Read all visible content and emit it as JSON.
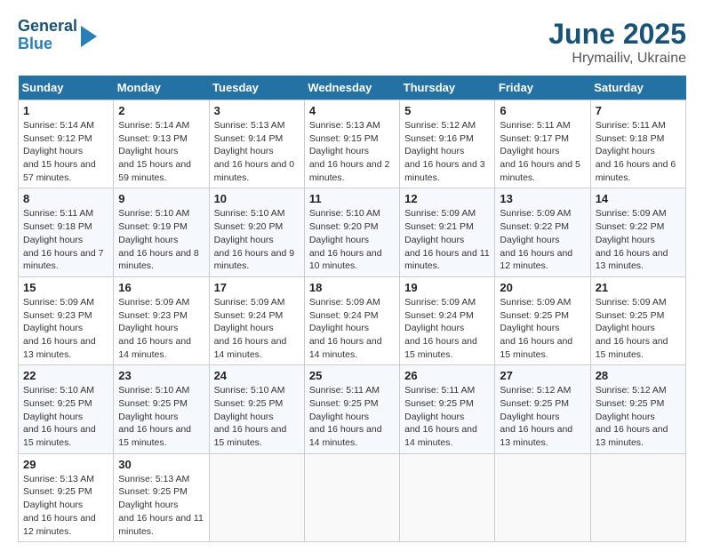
{
  "logo": {
    "line1": "General",
    "line2": "Blue"
  },
  "title": "June 2025",
  "subtitle": "Hrymailiv, Ukraine",
  "days_header": [
    "Sunday",
    "Monday",
    "Tuesday",
    "Wednesday",
    "Thursday",
    "Friday",
    "Saturday"
  ],
  "weeks": [
    [
      {
        "num": "1",
        "sunrise": "5:14 AM",
        "sunset": "9:12 PM",
        "daylight": "15 hours and 57 minutes."
      },
      {
        "num": "2",
        "sunrise": "5:14 AM",
        "sunset": "9:13 PM",
        "daylight": "15 hours and 59 minutes."
      },
      {
        "num": "3",
        "sunrise": "5:13 AM",
        "sunset": "9:14 PM",
        "daylight": "16 hours and 0 minutes."
      },
      {
        "num": "4",
        "sunrise": "5:13 AM",
        "sunset": "9:15 PM",
        "daylight": "16 hours and 2 minutes."
      },
      {
        "num": "5",
        "sunrise": "5:12 AM",
        "sunset": "9:16 PM",
        "daylight": "16 hours and 3 minutes."
      },
      {
        "num": "6",
        "sunrise": "5:11 AM",
        "sunset": "9:17 PM",
        "daylight": "16 hours and 5 minutes."
      },
      {
        "num": "7",
        "sunrise": "5:11 AM",
        "sunset": "9:18 PM",
        "daylight": "16 hours and 6 minutes."
      }
    ],
    [
      {
        "num": "8",
        "sunrise": "5:11 AM",
        "sunset": "9:18 PM",
        "daylight": "16 hours and 7 minutes."
      },
      {
        "num": "9",
        "sunrise": "5:10 AM",
        "sunset": "9:19 PM",
        "daylight": "16 hours and 8 minutes."
      },
      {
        "num": "10",
        "sunrise": "5:10 AM",
        "sunset": "9:20 PM",
        "daylight": "16 hours and 9 minutes."
      },
      {
        "num": "11",
        "sunrise": "5:10 AM",
        "sunset": "9:20 PM",
        "daylight": "16 hours and 10 minutes."
      },
      {
        "num": "12",
        "sunrise": "5:09 AM",
        "sunset": "9:21 PM",
        "daylight": "16 hours and 11 minutes."
      },
      {
        "num": "13",
        "sunrise": "5:09 AM",
        "sunset": "9:22 PM",
        "daylight": "16 hours and 12 minutes."
      },
      {
        "num": "14",
        "sunrise": "5:09 AM",
        "sunset": "9:22 PM",
        "daylight": "16 hours and 13 minutes."
      }
    ],
    [
      {
        "num": "15",
        "sunrise": "5:09 AM",
        "sunset": "9:23 PM",
        "daylight": "16 hours and 13 minutes."
      },
      {
        "num": "16",
        "sunrise": "5:09 AM",
        "sunset": "9:23 PM",
        "daylight": "16 hours and 14 minutes."
      },
      {
        "num": "17",
        "sunrise": "5:09 AM",
        "sunset": "9:24 PM",
        "daylight": "16 hours and 14 minutes."
      },
      {
        "num": "18",
        "sunrise": "5:09 AM",
        "sunset": "9:24 PM",
        "daylight": "16 hours and 14 minutes."
      },
      {
        "num": "19",
        "sunrise": "5:09 AM",
        "sunset": "9:24 PM",
        "daylight": "16 hours and 15 minutes."
      },
      {
        "num": "20",
        "sunrise": "5:09 AM",
        "sunset": "9:25 PM",
        "daylight": "16 hours and 15 minutes."
      },
      {
        "num": "21",
        "sunrise": "5:09 AM",
        "sunset": "9:25 PM",
        "daylight": "16 hours and 15 minutes."
      }
    ],
    [
      {
        "num": "22",
        "sunrise": "5:10 AM",
        "sunset": "9:25 PM",
        "daylight": "16 hours and 15 minutes."
      },
      {
        "num": "23",
        "sunrise": "5:10 AM",
        "sunset": "9:25 PM",
        "daylight": "16 hours and 15 minutes."
      },
      {
        "num": "24",
        "sunrise": "5:10 AM",
        "sunset": "9:25 PM",
        "daylight": "16 hours and 15 minutes."
      },
      {
        "num": "25",
        "sunrise": "5:11 AM",
        "sunset": "9:25 PM",
        "daylight": "16 hours and 14 minutes."
      },
      {
        "num": "26",
        "sunrise": "5:11 AM",
        "sunset": "9:25 PM",
        "daylight": "16 hours and 14 minutes."
      },
      {
        "num": "27",
        "sunrise": "5:12 AM",
        "sunset": "9:25 PM",
        "daylight": "16 hours and 13 minutes."
      },
      {
        "num": "28",
        "sunrise": "5:12 AM",
        "sunset": "9:25 PM",
        "daylight": "16 hours and 13 minutes."
      }
    ],
    [
      {
        "num": "29",
        "sunrise": "5:13 AM",
        "sunset": "9:25 PM",
        "daylight": "16 hours and 12 minutes."
      },
      {
        "num": "30",
        "sunrise": "5:13 AM",
        "sunset": "9:25 PM",
        "daylight": "16 hours and 11 minutes."
      },
      null,
      null,
      null,
      null,
      null
    ]
  ]
}
